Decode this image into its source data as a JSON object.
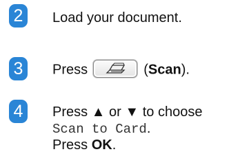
{
  "accent_color": "#2a85d6",
  "steps": [
    {
      "number": "2",
      "line1": "Load your document."
    },
    {
      "number": "3",
      "press": "Press",
      "button_icon": "scanner-icon",
      "open_paren": "(",
      "button_name": "Scan",
      "close_paren": ")."
    },
    {
      "number": "4",
      "line1": "Press ▲ or ▼ to choose",
      "option": "Scan to Card",
      "option_suffix": ".",
      "press": "Press",
      "key": "OK",
      "key_suffix": "."
    }
  ]
}
